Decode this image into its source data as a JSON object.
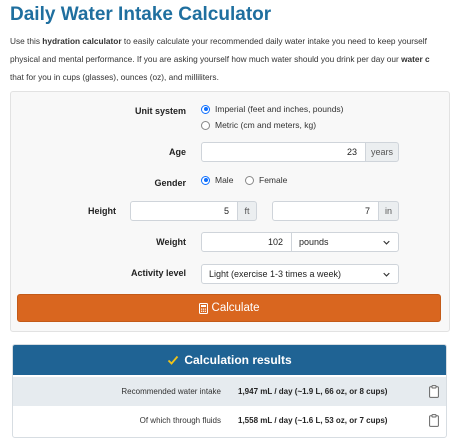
{
  "title": "Daily Water Intake Calculator",
  "intro": {
    "p1": "Use this ",
    "b1": "hydration calculator",
    "p2": " to easily calculate your recommended daily water intake you need to keep yourself",
    "p3": "physical and mental performance. If you are asking yourself how much water should you drink per day our ",
    "b2": "water c",
    "p4": "that for you in cups (glasses), ounces (oz), and milliliters."
  },
  "form": {
    "unit_system": {
      "label": "Unit system",
      "options": [
        "Imperial (feet and inches, pounds)",
        "Metric (cm and meters, kg)"
      ],
      "selected": "Imperial (feet and inches, pounds)"
    },
    "age": {
      "label": "Age",
      "value": "23",
      "unit": "years"
    },
    "gender": {
      "label": "Gender",
      "options": [
        "Male",
        "Female"
      ],
      "selected": "Male"
    },
    "height": {
      "label": "Height",
      "feet": "5",
      "feet_unit": "ft",
      "inches": "7",
      "inches_unit": "in"
    },
    "weight": {
      "label": "Weight",
      "value": "102",
      "unit": "pounds"
    },
    "activity": {
      "label": "Activity level",
      "value": "Light (exercise 1-3 times a week)"
    },
    "calculate_label": "Calculate"
  },
  "results": {
    "title": "Calculation results",
    "rows": [
      {
        "label": "Recommended water intake",
        "value": "1,947 mL / day (~1.9 L, 66 oz, or 8 cups)"
      },
      {
        "label": "Of which through fluids",
        "value": "1,558 mL / day (~1.6 L, 53 oz, or 7 cups)"
      }
    ]
  },
  "colors": {
    "title": "#1f6f9f",
    "calculate_button": "#d9661f",
    "results_header": "#1f6394",
    "check": "#f0c419",
    "radio_checked": "#0d6efd"
  },
  "icons": {
    "calculate": "calculator-icon",
    "results": "check-icon",
    "copy": "clipboard-icon",
    "select": "chevron-down-icon"
  }
}
